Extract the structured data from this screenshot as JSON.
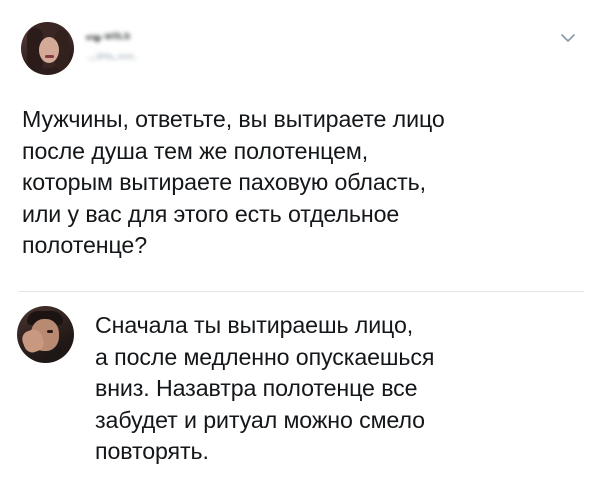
{
  "tweet": {
    "author_name": "•ч̷ ʷᴵˡᴸᵇ",
    "author_handle": "·˞ᵈᴴᵃ˞ᵉᵉᵉ·",
    "text": "Мужчины, ответьте, вы вытираете лицо\nпосле душа тем же полотенцем,\nкоторым вытираете паховую область,\nили у вас для этого есть отдельное\nполотенце?",
    "menu_icon": "chevron-down-icon"
  },
  "reply": {
    "text": "Сначала ты вытираешь лицо,\nа после медленно опускаешься\nвниз. Назавтра полотенце все\nзабудет и ритуал можно смело\nповторять."
  },
  "colors": {
    "text": "#14171a",
    "muted": "#8899a6",
    "divider": "#e1e8ed",
    "chevron": "#8899a6"
  }
}
